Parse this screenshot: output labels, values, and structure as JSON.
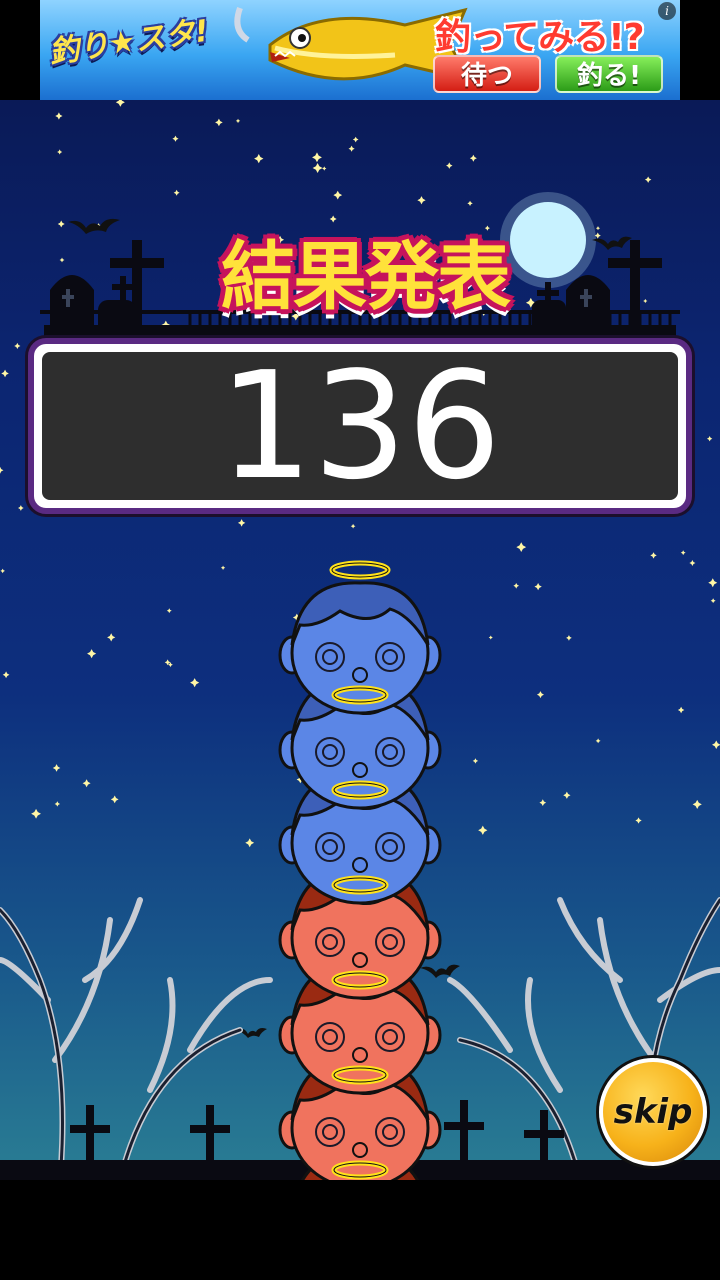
{
  "ad": {
    "logo": "釣り★スタ!",
    "headline": "釣ってみる!?",
    "wait_button": "待つ",
    "fish_button": "釣る!",
    "info_icon": "i"
  },
  "result": {
    "title": "結果発表",
    "score": "136"
  },
  "skip_button": "skip",
  "tower": {
    "heads": [
      {
        "color": "blue"
      },
      {
        "color": "blue"
      },
      {
        "color": "blue"
      },
      {
        "color": "red"
      },
      {
        "color": "red"
      },
      {
        "color": "red"
      },
      {
        "color": "red"
      }
    ]
  },
  "colors": {
    "sky_top": "#0a1a57",
    "sky_bottom": "#2a7e94",
    "title_fill": "#ffe23a",
    "title_outline": "#c6135c",
    "score_frame": "#5a2a82",
    "blue_head": "#5b86e6",
    "red_head": "#f0735e",
    "halo": "#ffe21a",
    "skip": "#f7b21a"
  }
}
